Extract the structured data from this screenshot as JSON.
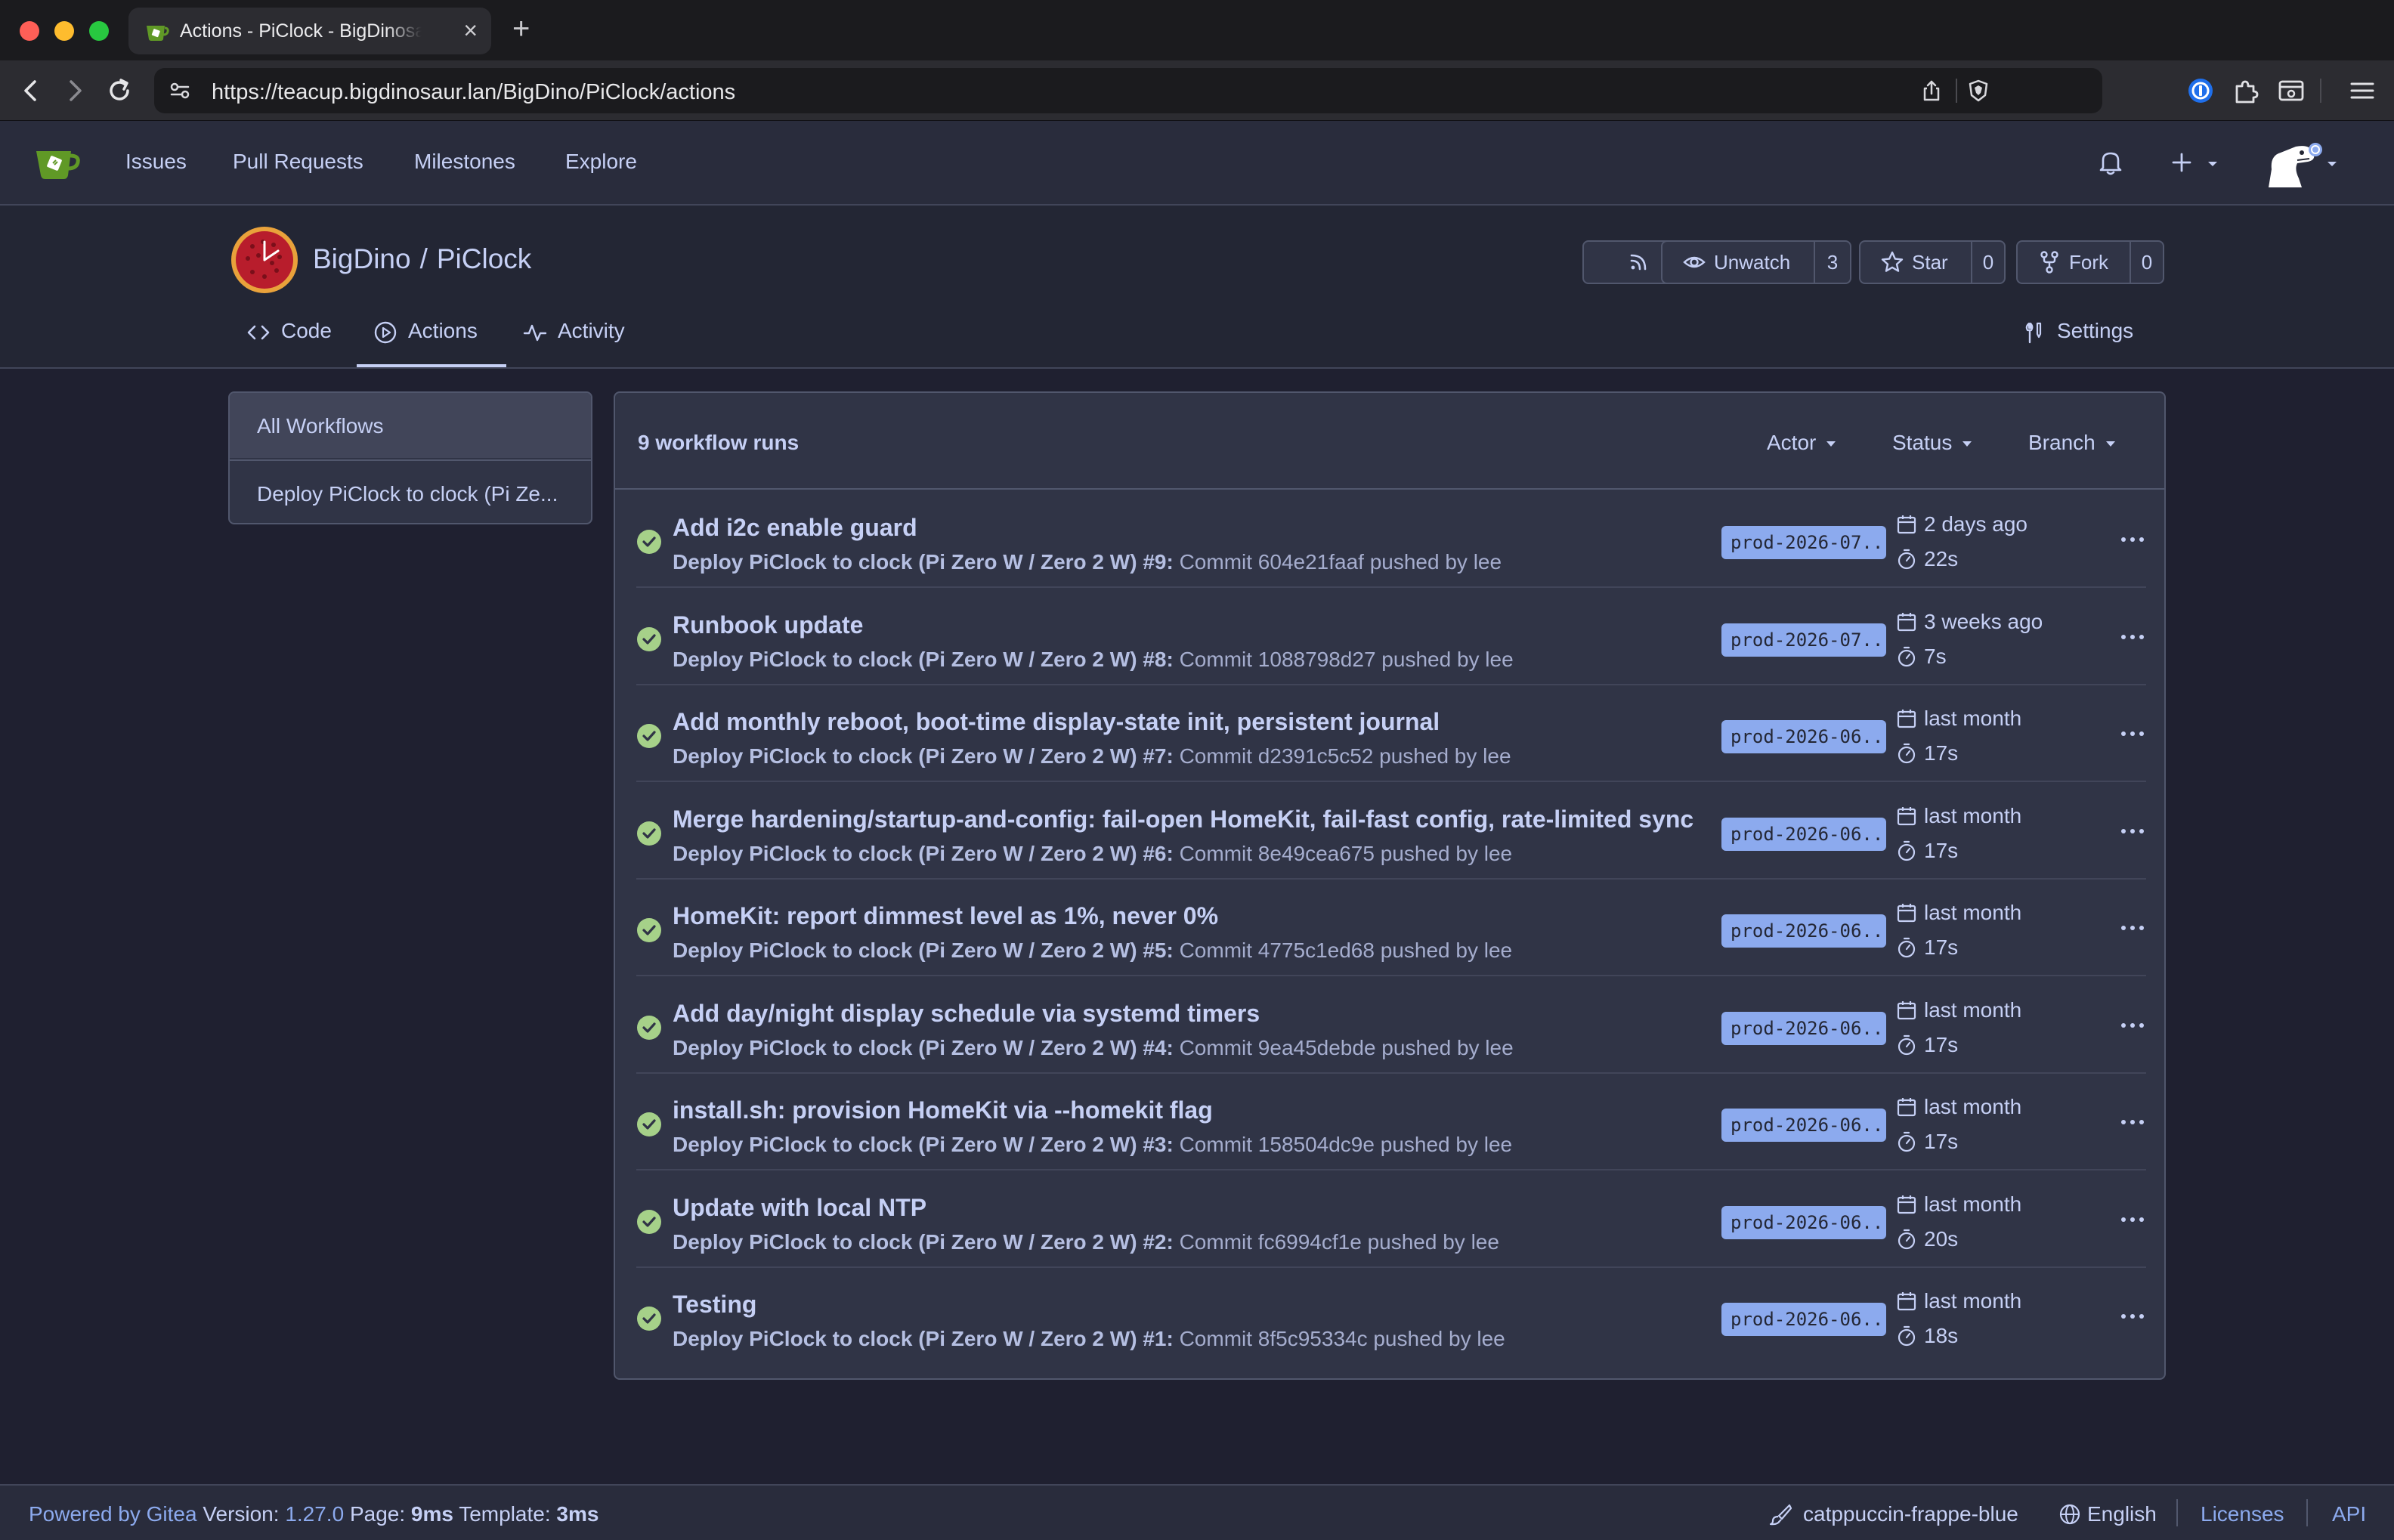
{
  "browser": {
    "tab_title": "Actions - PiClock - BigDinosaur",
    "url": "https://teacup.bigdinosaur.lan/BigDino/PiClock/actions"
  },
  "site_nav": {
    "issues": "Issues",
    "pull_requests": "Pull Requests",
    "milestones": "Milestones",
    "explore": "Explore"
  },
  "repo": {
    "owner": "BigDino",
    "separator": "/",
    "name": "PiClock",
    "unwatch_label": "Unwatch",
    "watch_count": "3",
    "star_label": "Star",
    "star_count": "0",
    "fork_label": "Fork",
    "fork_count": "0",
    "tabs": {
      "code": "Code",
      "actions": "Actions",
      "activity": "Activity",
      "settings": "Settings"
    }
  },
  "sidebar": {
    "items": [
      "All Workflows",
      "Deploy PiClock to clock (Pi Ze..."
    ]
  },
  "runs_panel": {
    "count_label": "9 workflow runs",
    "filters": {
      "actor": "Actor",
      "status": "Status",
      "branch": "Branch"
    },
    "runs": [
      {
        "title": "Add i2c enable guard",
        "workflow": "Deploy PiClock to clock (Pi Zero W / Zero 2 W) #9:",
        "detail": "Commit 604e21faaf pushed by lee",
        "branch": "prod-2026-07...",
        "time": "2 days ago",
        "duration": "22s",
        "status": "success"
      },
      {
        "title": "Runbook update",
        "workflow": "Deploy PiClock to clock (Pi Zero W / Zero 2 W) #8:",
        "detail": "Commit 1088798d27 pushed by lee",
        "branch": "prod-2026-07...",
        "time": "3 weeks ago",
        "duration": "7s",
        "status": "success"
      },
      {
        "title": "Add monthly reboot, boot-time display-state init, persistent journal",
        "workflow": "Deploy PiClock to clock (Pi Zero W / Zero 2 W) #7:",
        "detail": "Commit d2391c5c52 pushed by lee",
        "branch": "prod-2026-06...",
        "time": "last month",
        "duration": "17s",
        "status": "success"
      },
      {
        "title": "Merge hardening/startup-and-config: fail-open HomeKit, fail-fast config, rate-limited sync",
        "workflow": "Deploy PiClock to clock (Pi Zero W / Zero 2 W) #6:",
        "detail": "Commit 8e49cea675 pushed by lee",
        "branch": "prod-2026-06...",
        "time": "last month",
        "duration": "17s",
        "status": "success"
      },
      {
        "title": "HomeKit: report dimmest level as 1%, never 0%",
        "workflow": "Deploy PiClock to clock (Pi Zero W / Zero 2 W) #5:",
        "detail": "Commit 4775c1ed68 pushed by lee",
        "branch": "prod-2026-06...",
        "time": "last month",
        "duration": "17s",
        "status": "success"
      },
      {
        "title": "Add day/night display schedule via systemd timers",
        "workflow": "Deploy PiClock to clock (Pi Zero W / Zero 2 W) #4:",
        "detail": "Commit 9ea45debde pushed by lee",
        "branch": "prod-2026-06...",
        "time": "last month",
        "duration": "17s",
        "status": "success"
      },
      {
        "title": "install.sh: provision HomeKit via --homekit flag",
        "workflow": "Deploy PiClock to clock (Pi Zero W / Zero 2 W) #3:",
        "detail": "Commit 158504dc9e pushed by lee",
        "branch": "prod-2026-06...",
        "time": "last month",
        "duration": "17s",
        "status": "success"
      },
      {
        "title": "Update with local NTP",
        "workflow": "Deploy PiClock to clock (Pi Zero W / Zero 2 W) #2:",
        "detail": "Commit fc6994cf1e pushed by lee",
        "branch": "prod-2026-06...",
        "time": "last month",
        "duration": "20s",
        "status": "success"
      },
      {
        "title": "Testing",
        "workflow": "Deploy PiClock to clock (Pi Zero W / Zero 2 W) #1:",
        "detail": "Commit 8f5c95334c pushed by lee",
        "branch": "prod-2026-06...",
        "time": "last month",
        "duration": "18s",
        "status": "success"
      }
    ]
  },
  "footer": {
    "powered_by": "Powered by Gitea",
    "version_label": "Version:",
    "version": "1.27.0",
    "page_label": "Page:",
    "page_time": "9ms",
    "template_label": "Template:",
    "template_time": "3ms",
    "theme": "catppuccin-frappe-blue",
    "language": "English",
    "licenses": "Licenses",
    "api": "API"
  },
  "colors": {
    "background": "#232634",
    "panel": "#303446",
    "accent": "#8caaee",
    "success": "#a6d189",
    "text": "#c6d0f5"
  }
}
